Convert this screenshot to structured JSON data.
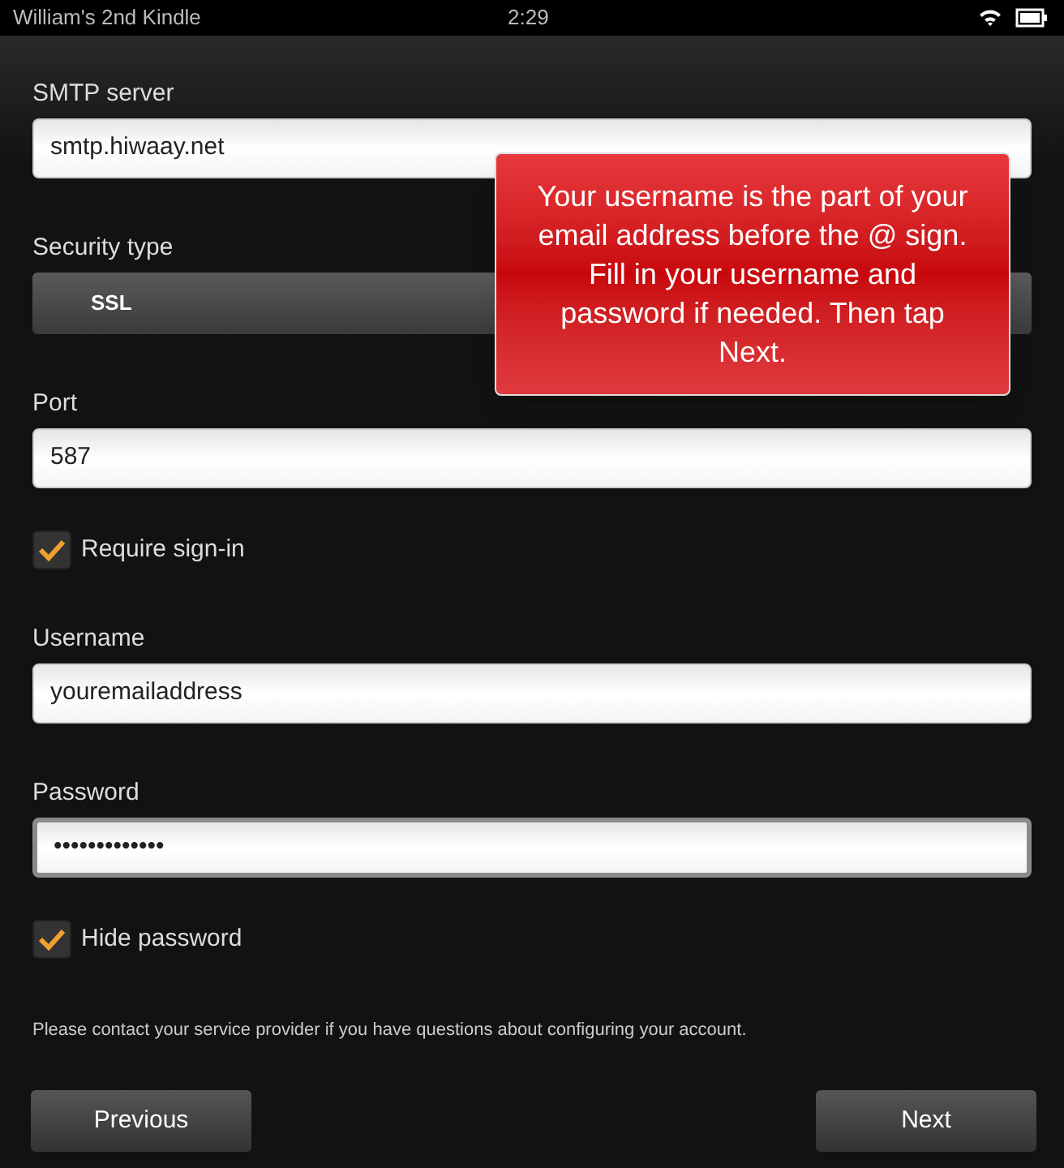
{
  "status_bar": {
    "device_name": "William's 2nd Kindle",
    "time": "2:29"
  },
  "form": [
    {
      "kind": "field",
      "label": "SMTP server",
      "value": "smtp.hiwaay.net",
      "focused": false
    },
    {
      "kind": "select",
      "label": "Security type",
      "value": "SSL"
    },
    {
      "kind": "field",
      "label": "Port",
      "value": "587",
      "focused": false
    },
    {
      "kind": "checkbox",
      "label": "Require sign-in",
      "checked": true
    },
    {
      "kind": "field",
      "label": "Username",
      "value": "youremailaddress",
      "focused": false
    },
    {
      "kind": "field",
      "label": "Password",
      "value": "•••••••••••••",
      "focused": true
    },
    {
      "kind": "checkbox",
      "label": "Hide password",
      "checked": true
    }
  ],
  "note": "Please contact your service provider if you have questions about configuring your account.",
  "buttons": {
    "previous": "Previous",
    "next": "Next"
  },
  "callout": "Your username is the part of your email address before the @ sign. Fill in your username and password if needed. Then tap Next."
}
